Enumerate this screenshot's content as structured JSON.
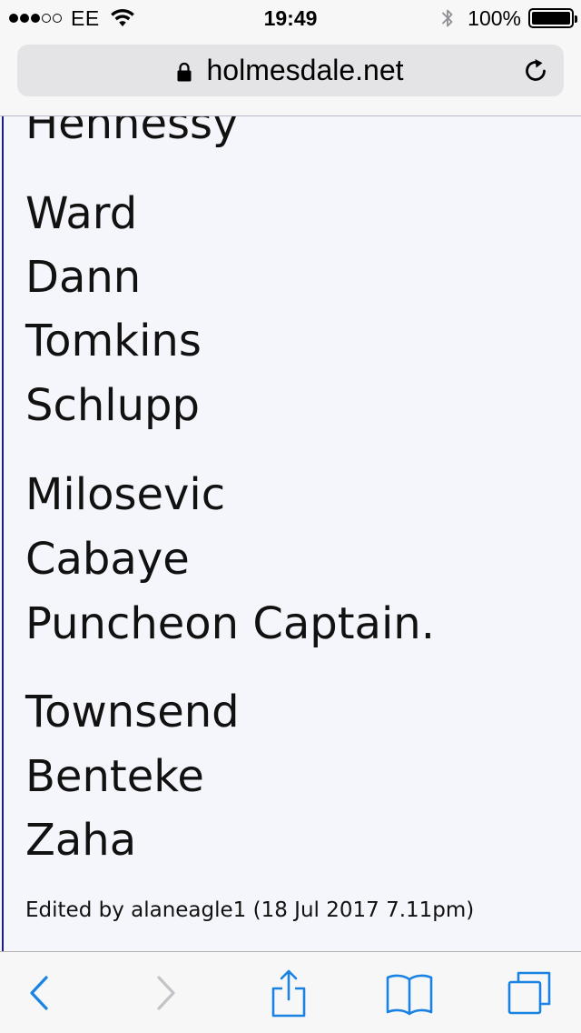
{
  "status_bar": {
    "carrier": "EE",
    "time": "19:49",
    "battery_percent": "100%",
    "signal_bars_filled": 3,
    "signal_bars_total": 5
  },
  "url_bar": {
    "domain": "holmesdale.net",
    "secure": true
  },
  "post": {
    "lines": [
      "Hennessy",
      "Ward",
      "Dann",
      "Tomkins",
      "Schlupp",
      "Milosevic",
      "Cabaye",
      "Puncheon Captain.",
      "Townsend",
      "Benteke",
      "Zaha"
    ],
    "edited_note": "Edited by alaneagle1 (18 Jul 2017 7.11pm)"
  },
  "toolbar": {
    "icons": [
      "back-icon",
      "forward-icon",
      "share-icon",
      "bookmarks-icon",
      "tabs-icon"
    ],
    "accent_color": "#1a82e2",
    "disabled_color": "#c4c4c8"
  }
}
